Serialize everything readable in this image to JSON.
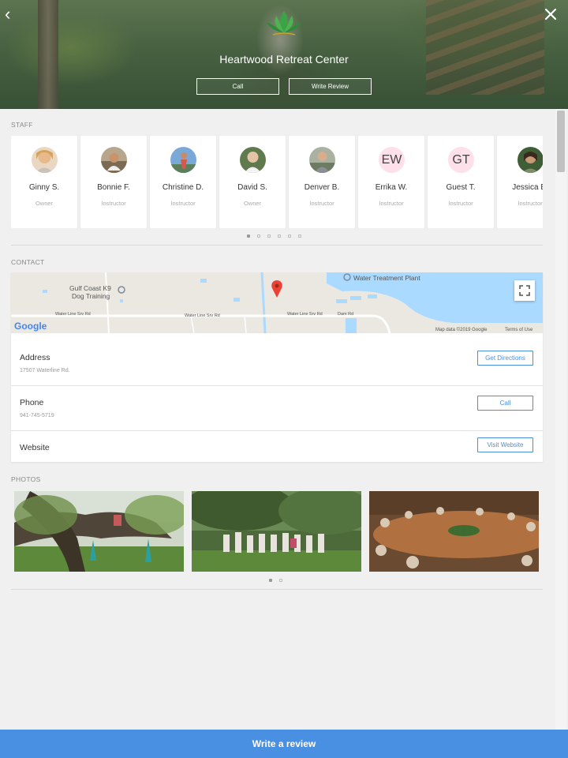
{
  "header": {
    "title": "Heartwood Retreat Center",
    "call_label": "Call",
    "write_review_label": "Write Review",
    "back_glyph": "‹"
  },
  "staff": {
    "section_label": "STAFF",
    "members": [
      {
        "name": "Ginny S.",
        "role": "Owner",
        "avatar": "photo",
        "color": "#e8b98a"
      },
      {
        "name": "Bonnie F.",
        "role": "Instructor",
        "avatar": "photo",
        "color": "#b98d67"
      },
      {
        "name": "Christine D.",
        "role": "Instructor",
        "avatar": "photo",
        "color": "#6a9ad2"
      },
      {
        "name": "David S.",
        "role": "Owner",
        "avatar": "photo",
        "color": "#6f8f5a"
      },
      {
        "name": "Denver B.",
        "role": "Instructor",
        "avatar": "photo",
        "color": "#8e9a86"
      },
      {
        "name": "Errika W.",
        "role": "Instructor",
        "avatar": "EW",
        "color": "#fde0ea"
      },
      {
        "name": "Guest T.",
        "role": "Instructor",
        "avatar": "GT",
        "color": "#fde0ea"
      },
      {
        "name": "Jessica B.",
        "role": "Instructor",
        "avatar": "photo",
        "color": "#55704a"
      }
    ],
    "pagination_pages": 6,
    "pagination_active": 0
  },
  "contact": {
    "section_label": "CONTACT",
    "map": {
      "labels": [
        "Gulf Coast K9",
        "Dog Training",
        "Water Treatment Plant",
        "Water Line Srv Rd",
        "Water Line Srv Rd",
        "Water Line Srv Rd",
        "Dam Rd",
        "Map data ©2019 Google",
        "Terms of Use"
      ],
      "brand": "Google"
    },
    "rows": [
      {
        "label": "Address",
        "value": "17507 Waterline Rd.",
        "button": "Get Directions"
      },
      {
        "label": "Phone",
        "value": "941-745-5719",
        "button": "Call"
      },
      {
        "label": "Website",
        "value": "",
        "button": "Visit Website"
      }
    ]
  },
  "photos": {
    "section_label": "PHOTOS",
    "pagination_pages": 2,
    "pagination_active": 0
  },
  "footer": {
    "write_review_label": "Write a review"
  },
  "colors": {
    "accent": "#4a90e2",
    "button_outline": "#4a90d9",
    "page_bg": "#f0f0f0"
  }
}
